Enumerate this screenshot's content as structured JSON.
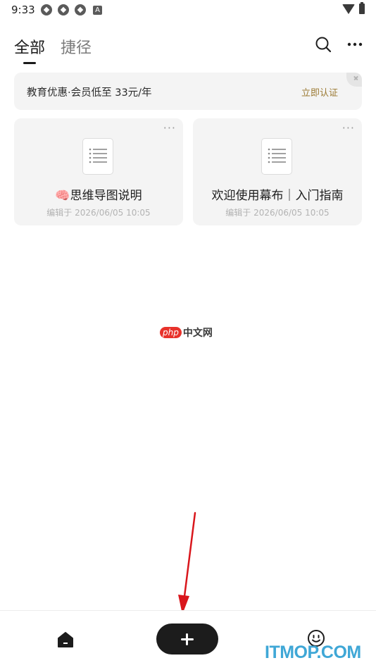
{
  "status_bar": {
    "time": "9:33",
    "notification_letter": "A"
  },
  "header": {
    "tabs": [
      {
        "label": "全部",
        "active": true
      },
      {
        "label": "捷径",
        "active": false
      }
    ]
  },
  "banner": {
    "text": "教育优惠·会员低至 33元/年",
    "action_label": "立即认证"
  },
  "documents": [
    {
      "title": "🧠思维导图说明",
      "meta": "编辑于 2026/06/05 10:05",
      "more": "···"
    },
    {
      "title": "欢迎使用幕布｜入门指南",
      "meta": "编辑于 2026/06/05 10:05",
      "more": "···"
    }
  ],
  "watermark": {
    "brand": "php",
    "text": "中文网"
  },
  "bottom_nav": {
    "items": [
      "home-icon",
      "add-button",
      "smile-icon"
    ]
  },
  "site_watermark": "ITMOP.COM",
  "colors": {
    "accent": "#9b7a33",
    "fab": "#1c1c1c",
    "arrow": "#d9161c"
  }
}
